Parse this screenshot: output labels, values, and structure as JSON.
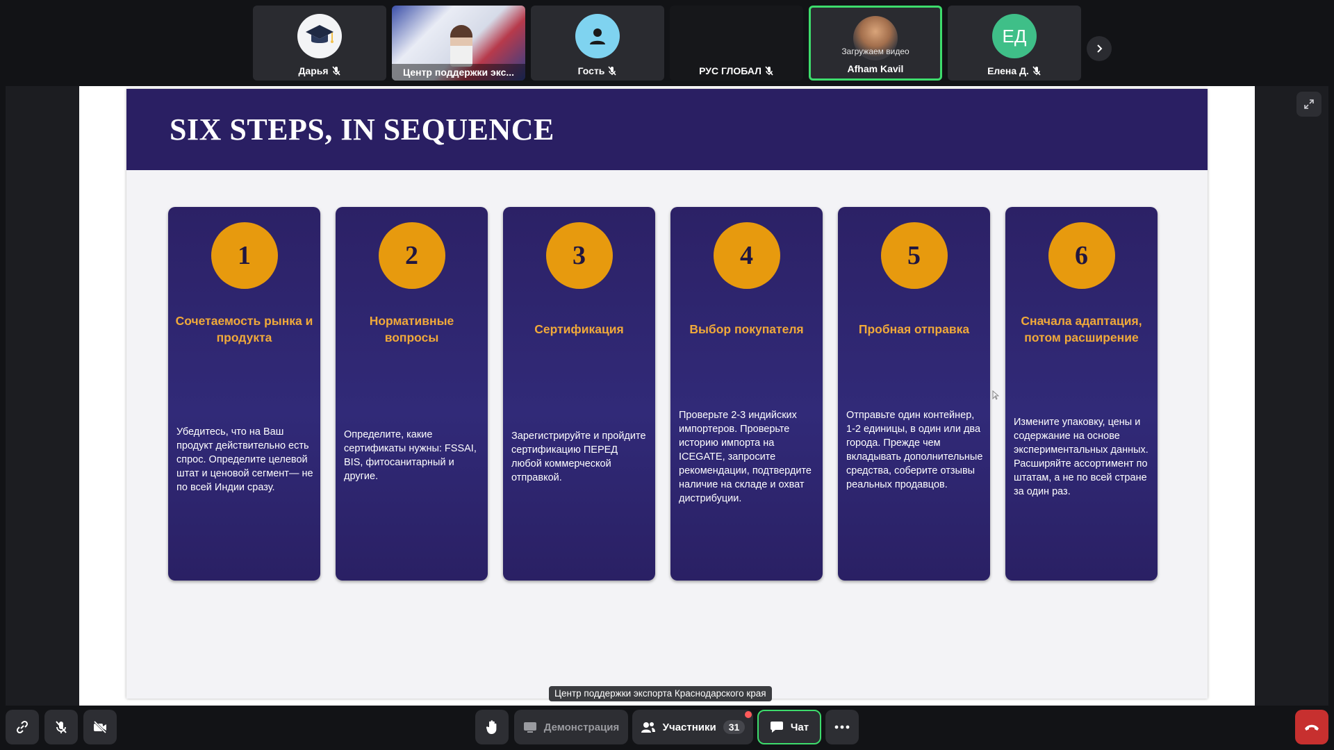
{
  "participants": [
    {
      "name": "Дарья",
      "avatar": "graduation-cap",
      "mic": "off"
    },
    {
      "name": "Центр поддержки экс...",
      "avatar": "screen-share",
      "mic": "on"
    },
    {
      "name": "Гость",
      "avatar": "user-silhouette",
      "mic": "off"
    },
    {
      "name": "РУС ГЛОБАЛ",
      "avatar": "none",
      "mic": "off"
    },
    {
      "name": "Afham Kavil",
      "avatar": "photo",
      "status": "Загружаем видео",
      "mic": "on",
      "active": true
    },
    {
      "name": "Елена Д.",
      "avatar": "initials",
      "initials": "ЕД",
      "mic": "off"
    }
  ],
  "slide": {
    "title": "SIX STEPS, IN SEQUENCE",
    "steps": [
      {
        "number": "1",
        "title": "Сочетаемость рынка и продукта",
        "description": "Убедитесь, что на Ваш продукт действительно есть спрос. Определите целевой штат и ценовой сегмент— не по всей Индии сразу."
      },
      {
        "number": "2",
        "title": "Нормативные вопросы",
        "description": "Определите, какие сертификаты нужны: FSSAI, BIS, фитосанитарный и другие."
      },
      {
        "number": "3",
        "title": "Сертификация",
        "description": "Зарегистрируйте и пройдите сертификацию ПЕРЕД любой коммерческой отправкой."
      },
      {
        "number": "4",
        "title": "Выбор покупателя",
        "description": "Проверьте 2-3 индийских импортеров. Проверьте историю импорта на ICEGATE, запросите рекомендации, подтвердите наличие на складе и охват дистрибуции."
      },
      {
        "number": "5",
        "title": "Пробная отправка",
        "description": "Отправьте один контейнер, 1-2 единицы, в один или два города. Прежде чем вкладывать дополнительные средства, соберите отзывы реальных продавцов."
      },
      {
        "number": "6",
        "title": "Сначала адаптация, потом расширение",
        "description": "Измените упаковку, цены и содержание на основе экспериментальных данных. Расширяйте ассортимент по штатам, а не по всей стране за один раз."
      }
    ]
  },
  "presenter_caption": "Центр поддержки экспорта Краснодарского края",
  "toolbar": {
    "demo_label": "Демонстрация",
    "participants_label": "Участники",
    "participants_count": "31",
    "chat_label": "Чат"
  },
  "colors": {
    "slide_header": "#2a1f63",
    "card_bg": "#2c2166",
    "number_circle": "#e79a0e",
    "card_title": "#f0a93a",
    "active_border": "#3ddc6c",
    "hangup": "#c7302f"
  }
}
